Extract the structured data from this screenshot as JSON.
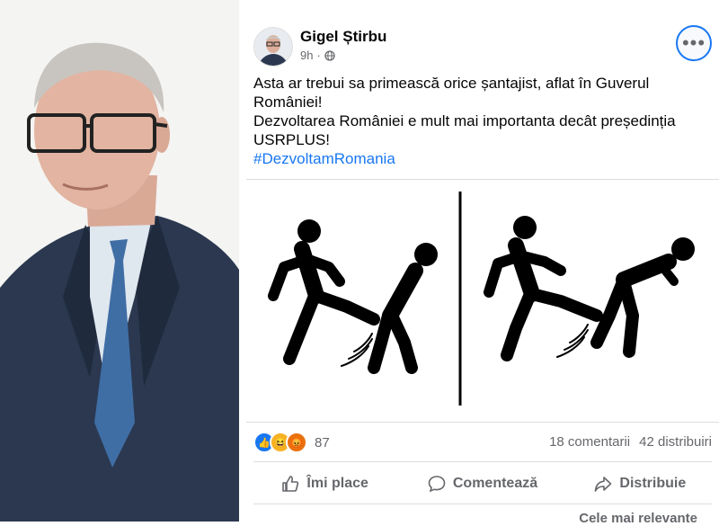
{
  "post": {
    "author": "Gigel Știrbu",
    "time": "9h",
    "privacy_icon": "globe-icon",
    "text_lines": [
      "Asta ar trebui sa primească orice șantajist, aflat în Guverul",
      "României!",
      "Dezvoltarea României e mult mai importanta decât președinția",
      "USRPLUS!"
    ],
    "hashtag": "#DezvoltamRomania"
  },
  "reactions": {
    "types": [
      "like",
      "haha",
      "angry"
    ],
    "count": "87",
    "comments": "18 comentarii",
    "shares": "42 distribuiri"
  },
  "actions": {
    "like": "Îmi place",
    "comment": "Comentează",
    "share": "Distribuie"
  },
  "comments_sort": "Cele mai relevante",
  "colors": {
    "accent": "#1877f2",
    "muted_text": "#65676b",
    "suit": "#2b3850"
  }
}
